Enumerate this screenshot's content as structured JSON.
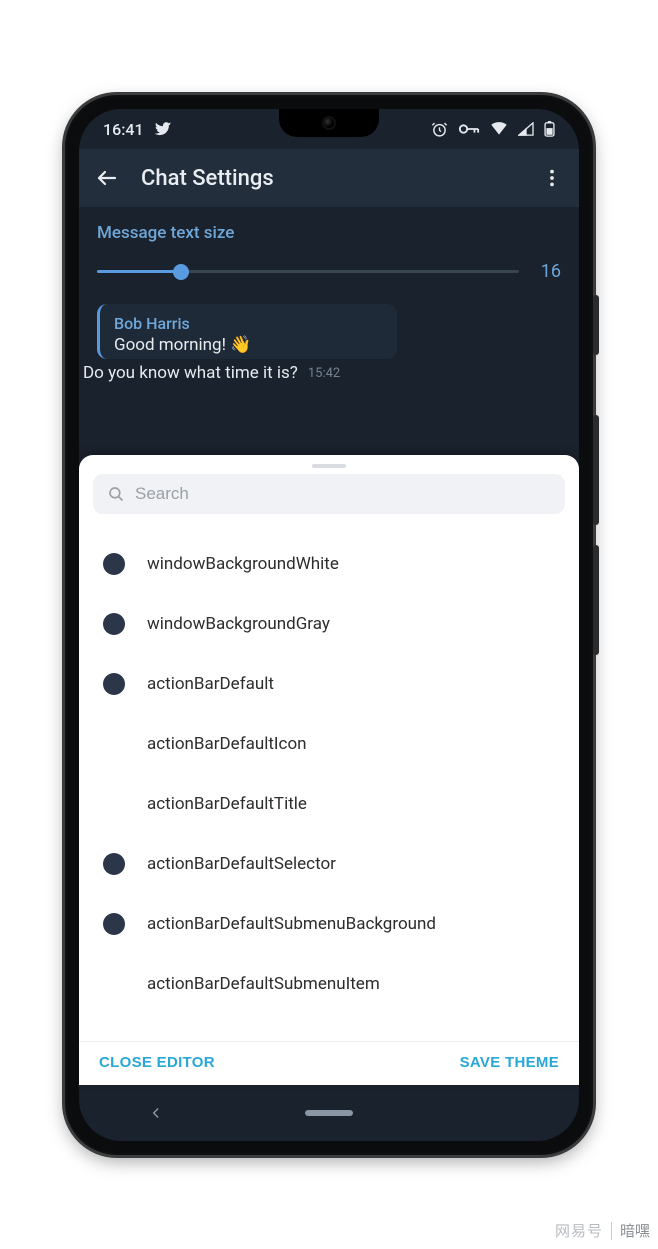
{
  "status": {
    "time": "16:41"
  },
  "appbar": {
    "title": "Chat Settings"
  },
  "textsize": {
    "label": "Message text size",
    "value": "16"
  },
  "preview": {
    "name": "Bob Harris",
    "line1": "Good morning! 👋",
    "line2": "Do you know what time it is?",
    "time": "15:42"
  },
  "search": {
    "placeholder": "Search"
  },
  "colors": {
    "dark": "#2b3748"
  },
  "items": [
    {
      "label": "windowBackgroundWhite",
      "swatch": "#2b3748"
    },
    {
      "label": "windowBackgroundGray",
      "swatch": "#2b3748"
    },
    {
      "label": "actionBarDefault",
      "swatch": "#2b3748"
    },
    {
      "label": "actionBarDefaultIcon",
      "swatch": null
    },
    {
      "label": "actionBarDefaultTitle",
      "swatch": null
    },
    {
      "label": "actionBarDefaultSelector",
      "swatch": "#2b3748"
    },
    {
      "label": "actionBarDefaultSubmenuBackground",
      "swatch": "#2b3748"
    },
    {
      "label": "actionBarDefaultSubmenuItem",
      "swatch": null
    }
  ],
  "footer": {
    "close": "CLOSE EDITOR",
    "save": "SAVE THEME"
  },
  "watermark": {
    "brand": "网易号",
    "sub": "暗嘿"
  }
}
